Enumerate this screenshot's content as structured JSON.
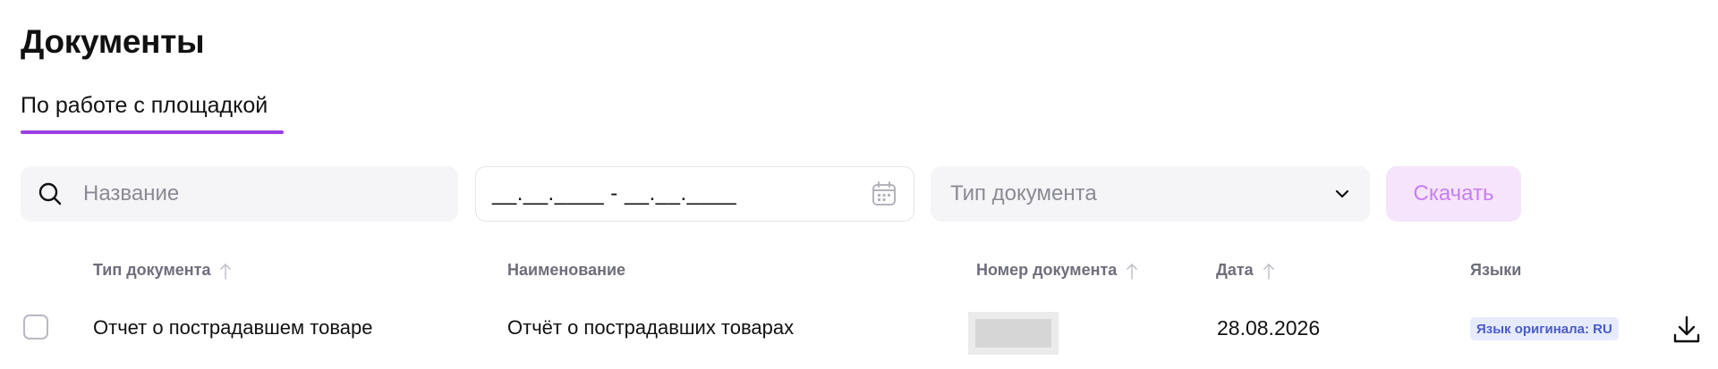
{
  "page": {
    "title": "Документы"
  },
  "tabs": [
    {
      "label": "По работе с площадкой",
      "active": true
    }
  ],
  "filters": {
    "search": {
      "placeholder": "Название",
      "value": ""
    },
    "date_range": {
      "mask": "__.__.____ - __.__.____"
    },
    "doc_type": {
      "placeholder": "Тип документа"
    },
    "download_label": "Скачать"
  },
  "table": {
    "columns": [
      {
        "label": "Тип документа",
        "sortable": true
      },
      {
        "label": "Наименование",
        "sortable": false
      },
      {
        "label": "Номер документа",
        "sortable": true
      },
      {
        "label": "Дата",
        "sortable": true
      },
      {
        "label": "Языки",
        "sortable": false
      }
    ],
    "rows": [
      {
        "type": "Отчет о пострадавшем товаре",
        "name": "Отчёт о пострадавших товарах",
        "number": "",
        "date": "28.08.2026",
        "language": "Язык оригинала: RU"
      }
    ]
  },
  "colors": {
    "accent": "#9a3fe6",
    "download_button_bg": "#f6e4fc",
    "download_button_text": "#c77ef0",
    "badge_bg": "#e6ebff",
    "badge_text": "#4a5cc8"
  },
  "icons": {
    "search": "search-icon",
    "calendar": "calendar-icon",
    "chevron": "chevron-down-icon",
    "sort": "arrow-up-icon",
    "download": "download-icon"
  }
}
